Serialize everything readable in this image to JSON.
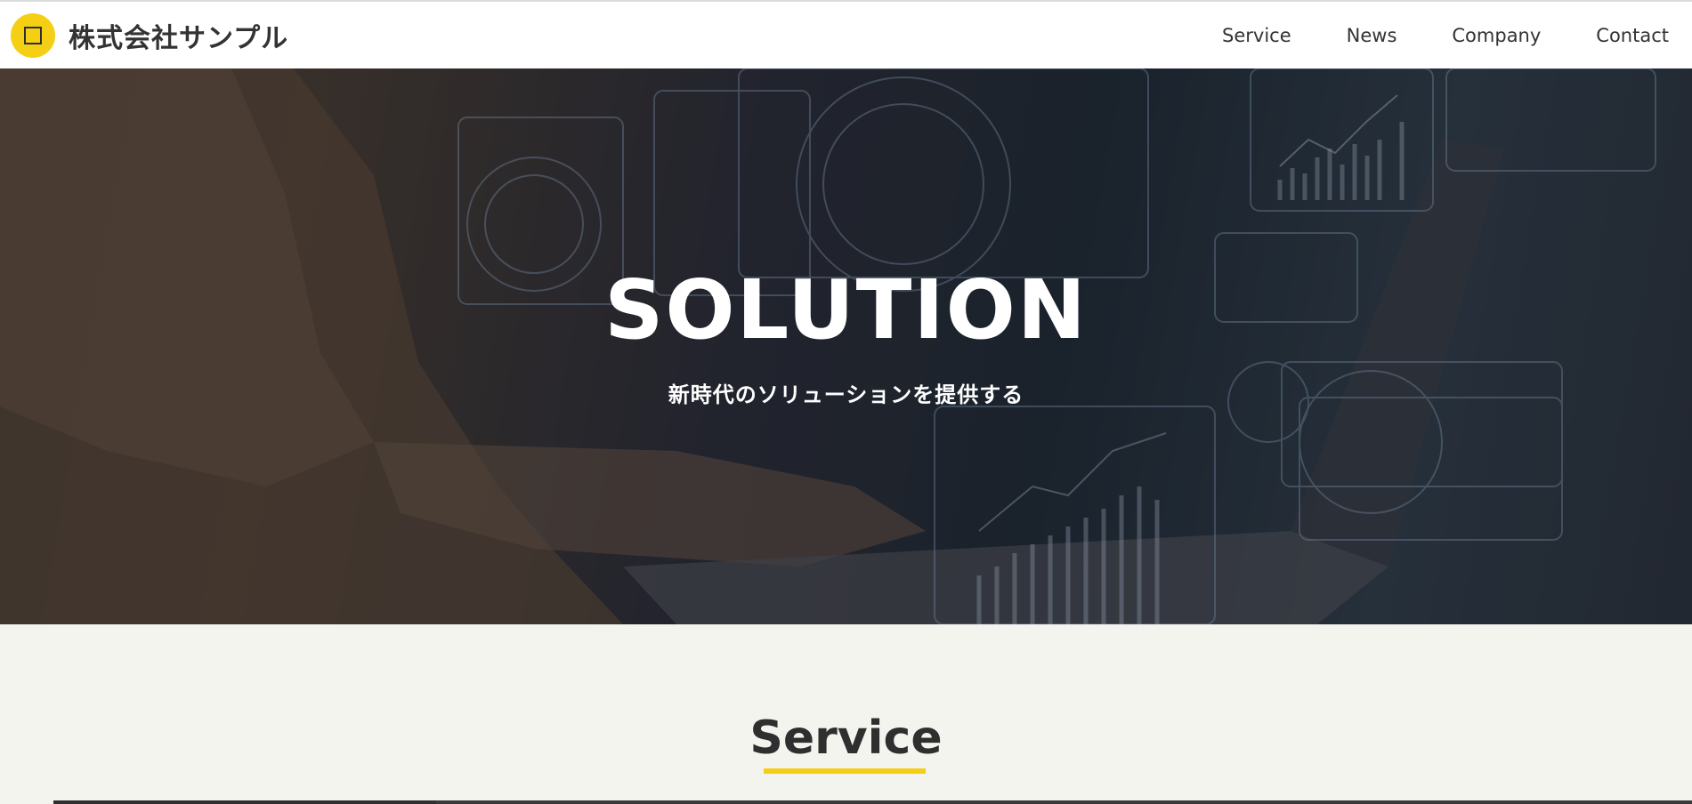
{
  "header": {
    "company_name": "株式会社サンプル",
    "logo_icon": "square-icon",
    "accent_color": "#f5cf14",
    "nav": [
      {
        "label": "Service"
      },
      {
        "label": "News"
      },
      {
        "label": "Company"
      },
      {
        "label": "Contact"
      }
    ]
  },
  "hero": {
    "title": "SOLUTION",
    "subtitle": "新時代のソリューションを提供する"
  },
  "service": {
    "title": "Service"
  }
}
